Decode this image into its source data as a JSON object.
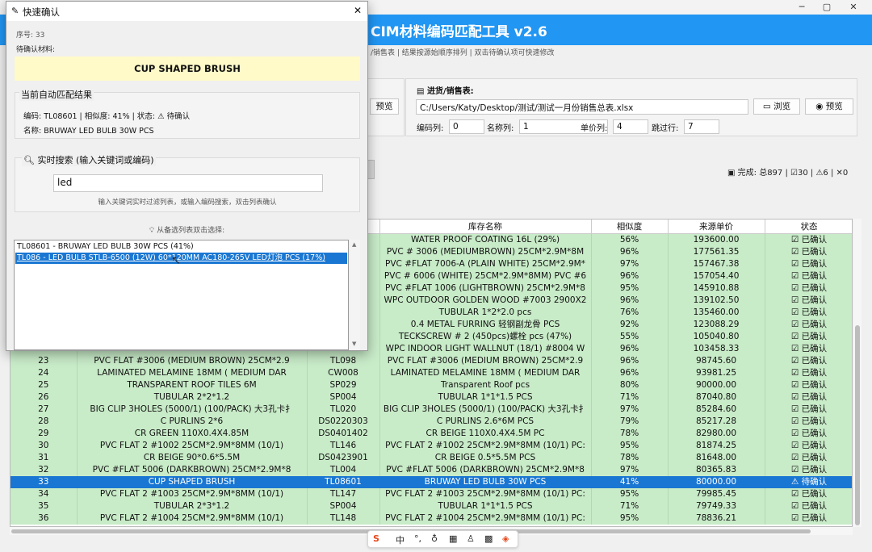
{
  "main": {
    "title": "CIM材料编码匹配工具 v2.6",
    "subtitle": "/销售表 | 结果按源始顺序排列 | 双击待确认项可快速修改",
    "sales_section": {
      "label": "进货/销售表:",
      "path": "C:/Users/Katy/Desktop/测试/测试一月份销售总表.xlsx",
      "browse_label": "浏览",
      "preview_label": "预览",
      "left_preview_label": "预览",
      "code_col_label": "编码列:",
      "code_col_value": "0",
      "name_col_label": "名称列:",
      "name_col_value": "1",
      "price_col_label": "单价列:",
      "price_col_value": "4",
      "skip_rows_label": "跳过行:",
      "skip_rows_value": "7"
    },
    "status_bar": {
      "done_label": "完成: 总897 |",
      "confirmed": "30 |",
      "pending": "6 |",
      "failed": "0"
    },
    "table": {
      "headers": [
        "",
        "",
        "",
        "库存名称",
        "相似度",
        "来源单价",
        "状态"
      ],
      "rows": [
        {
          "no": "",
          "name": "",
          "code": "",
          "stock": "WATER PROOF COATING 16L (29%)",
          "sim": "56%",
          "price": "193600.00",
          "status": "已确认"
        },
        {
          "no": "",
          "name": "",
          "code": "",
          "stock": "PVC # 3006 (MEDIUMBROWN) 25CM*2.9M*8M",
          "sim": "96%",
          "price": "177561.35",
          "status": "已确认"
        },
        {
          "no": "",
          "name": "",
          "code": "",
          "stock": "PVC #FLAT 7006-A (PLAIN WHITE) 25CM*2.9M*",
          "sim": "97%",
          "price": "157467.38",
          "status": "已确认"
        },
        {
          "no": "",
          "name": "",
          "code": "",
          "stock": "PVC # 6006 (WHITE) 25CM*2.9M*8MM) PVC #6",
          "sim": "96%",
          "price": "157054.40",
          "status": "已确认"
        },
        {
          "no": "",
          "name": "",
          "code": "",
          "stock": "PVC #FLAT 1006 (LIGHTBROWN) 25CM*2.9M*8",
          "sim": "95%",
          "price": "145910.88",
          "status": "已确认"
        },
        {
          "no": "",
          "name": "",
          "code": "",
          "stock": "WPC OUTDOOR GOLDEN WOOD #7003 2900X2",
          "sim": "96%",
          "price": "139102.50",
          "status": "已确认"
        },
        {
          "no": "",
          "name": "",
          "code": "",
          "stock": "TUBULAR 1*2*2.0 pcs",
          "sim": "76%",
          "price": "135460.00",
          "status": "已确认"
        },
        {
          "no": "",
          "name": "",
          "code": "",
          "stock": "0.4 METAL FURRING  轻钢副龙骨 PCS",
          "sim": "92%",
          "price": "123088.29",
          "status": "已确认"
        },
        {
          "no": "",
          "name": "",
          "code": "",
          "stock": "TECKSCREW # 2 (450pcs)螺栓 pcs (47%)",
          "sim": "55%",
          "price": "105040.80",
          "status": "已确认"
        },
        {
          "no": "",
          "name": "",
          "code": "",
          "stock": "WPC INDOOR LIGHT WALLNUT (18/1) #8004  W",
          "sim": "96%",
          "price": "103458.33",
          "status": "已确认"
        },
        {
          "no": "23",
          "name": "PVC  FLAT #3006 (MEDIUM BROWN) 25CM*2.9",
          "code": "TL098",
          "stock": "PVC  FLAT #3006 (MEDIUM BROWN) 25CM*2.9",
          "sim": "96%",
          "price": "98745.60",
          "status": "已确认"
        },
        {
          "no": "24",
          "name": "LAMINATED MELAMINE 18MM ( MEDIUM DAR",
          "code": "CW008",
          "stock": "LAMINATED MELAMINE 18MM ( MEDIUM DAR",
          "sim": "96%",
          "price": "93981.25",
          "status": "已确认"
        },
        {
          "no": "25",
          "name": "TRANSPARENT ROOF TILES 6M",
          "code": "SP029",
          "stock": "Transparent Roof pcs",
          "sim": "80%",
          "price": "90000.00",
          "status": "已确认"
        },
        {
          "no": "26",
          "name": "TUBULAR 2*2*1.2",
          "code": "SP004",
          "stock": "TUBULAR 1*1*1.5 PCS",
          "sim": "71%",
          "price": "87040.80",
          "status": "已确认"
        },
        {
          "no": "27",
          "name": "BIG CLIP 3HOLES (5000/1) (100/PACK)  大3孔卡扌",
          "code": "TL020",
          "stock": "BIG CLIP 3HOLES (5000/1) (100/PACK)  大3孔卡扌",
          "sim": "97%",
          "price": "85284.60",
          "status": "已确认"
        },
        {
          "no": "28",
          "name": "C PURLINS 2*6",
          "code": "DS0220303",
          "stock": "C PURLINS 2.6*6M PCS",
          "sim": "79%",
          "price": "85217.28",
          "status": "已确认"
        },
        {
          "no": "29",
          "name": "CR GREEN 110X0.4X4.85M",
          "code": "DS0401402",
          "stock": "CR BEIGE 110X0.4X4.5M PC",
          "sim": "78%",
          "price": "82980.00",
          "status": "已确认"
        },
        {
          "no": "30",
          "name": "PVC FLAT 2 #1002 25CM*2.9M*8MM (10/1)",
          "code": "TL146",
          "stock": "PVC FLAT 2 #1002 25CM*2.9M*8MM (10/1) PC:",
          "sim": "95%",
          "price": "81874.25",
          "status": "已确认"
        },
        {
          "no": "31",
          "name": "CR BEIGE 90*0.6*5.5M",
          "code": "DS0423901",
          "stock": "CR BEIGE 0.5*5.5M PCS",
          "sim": "78%",
          "price": "81648.00",
          "status": "已确认"
        },
        {
          "no": "32",
          "name": "PVC #FLAT 5006 (DARKBROWN) 25CM*2.9M*8",
          "code": "TL004",
          "stock": "PVC #FLAT 5006 (DARKBROWN) 25CM*2.9M*8",
          "sim": "97%",
          "price": "80365.83",
          "status": "已确认"
        },
        {
          "no": "33",
          "name": "CUP SHAPED BRUSH",
          "code": "TL08601",
          "stock": "BRUWAY LED BULB 30W PCS",
          "sim": "41%",
          "price": "80000.00",
          "status": "待确认",
          "selected": true
        },
        {
          "no": "34",
          "name": "PVC FLAT 2 #1003 25CM*2.9M*8MM (10/1)",
          "code": "TL147",
          "stock": "PVC FLAT 2 #1003 25CM*2.9M*8MM (10/1) PC:",
          "sim": "95%",
          "price": "79985.45",
          "status": "已确认"
        },
        {
          "no": "35",
          "name": "TUBULAR 2*3*1.2",
          "code": "SP004",
          "stock": "TUBULAR 1*1*1.5 PCS",
          "sim": "71%",
          "price": "79749.33",
          "status": "已确认"
        },
        {
          "no": "36",
          "name": "PVC FLAT 2 #1004 25CM*2.9M*8MM (10/1)",
          "code": "TL148",
          "stock": "PVC FLAT 2 #1004 25CM*2.9M*8MM (10/1) PC:",
          "sim": "95%",
          "price": "78836.21",
          "status": "已确认"
        }
      ]
    }
  },
  "dialog": {
    "title": "快速确认",
    "seq_label": "序号: 33",
    "pending_label": "待确认材料:",
    "material": "CUP SHAPED BRUSH",
    "current_title": "当前自动匹配结果",
    "current_line1": "编码: TL08601  |  相似度: 41%  |  状态: ⚠ 待确认",
    "current_line2": "名称: BRUWAY LED BULB 30W PCS",
    "search_title": "实时搜索 (输入关键词或编码)",
    "search_value": "led",
    "search_hint": "输入关键词实时过滤列表，或输入编码搜索，双击列表确认",
    "candidates_hint": "从备选列表双击选择:",
    "candidates": [
      "TL08601 - BRUWAY LED BULB 30W PCS (41%)",
      "TL086 - LED BULB STLB-6500 (12W) 60*120MM AC180-265V  LED灯泡 PCS (17%)"
    ]
  },
  "ime": {
    "chinese": "中"
  },
  "colors": {
    "accent": "#2196f3",
    "confirmed_row": "#c8ebc8",
    "selected_row": "#1976d2",
    "material_bg": "#fffac8"
  }
}
